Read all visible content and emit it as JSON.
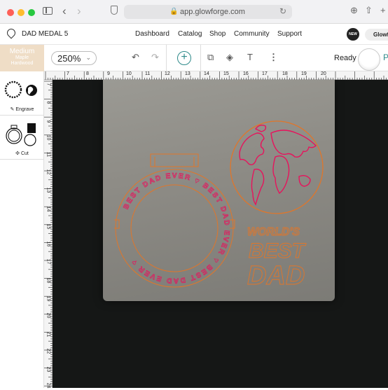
{
  "browser": {
    "url": "app.glowforge.com",
    "icons": [
      "sidebar-icon",
      "back-arrow-icon",
      "forward-arrow-icon",
      "shield-icon",
      "lock-icon",
      "reload-icon",
      "download-icon",
      "share-icon",
      "new-tab-icon"
    ]
  },
  "header": {
    "title": "DAD MEDAL 5",
    "nav": [
      "Dashboard",
      "Catalog",
      "Shop",
      "Community",
      "Support"
    ],
    "badge": "NEW",
    "account": "Glowf"
  },
  "toolbar": {
    "material_name": "Medium",
    "material_type_1": "Maple",
    "material_type_2": "Hardwood",
    "zoom": "250%",
    "status": "Ready",
    "status_letter": "P"
  },
  "panel": {
    "engrave_label": "Engrave",
    "cut_label": "Cut"
  },
  "ruler": {
    "top": [
      "7",
      "8",
      "9",
      "10",
      "11",
      "12",
      "13",
      "14",
      "15",
      "16",
      "17",
      "18",
      "19",
      "20"
    ],
    "left": [
      "7",
      "8",
      "9",
      "10",
      "11",
      "12",
      "13",
      "14",
      "15",
      "16",
      "17",
      "18",
      "19",
      "20",
      "21",
      "22",
      "23",
      "24"
    ]
  },
  "design": {
    "ring_text": "BEST DAD EVER ♥ BEST DAD EVER ♥ BEST DAD EVER ♥",
    "worlds": "WORLD'S",
    "best": "BEST",
    "dad": "DAD",
    "engrave_color": "#e8125c",
    "cut_color": "#e0762a"
  },
  "colors": {
    "accent": "#2e8a8a",
    "material_bg": "#efddc6"
  }
}
